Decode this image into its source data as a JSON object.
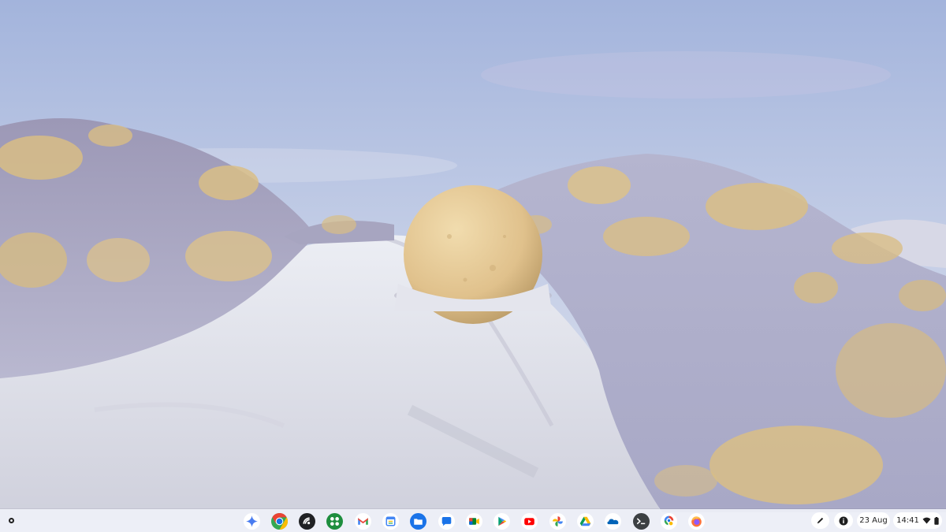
{
  "shelf": {
    "launcher": {
      "icon": "launcher-icon"
    },
    "apps": [
      {
        "name": "gemini",
        "icon": "gemini-icon"
      },
      {
        "name": "chrome",
        "icon": "chrome-icon"
      },
      {
        "name": "android-connect",
        "icon": "android-connect-icon"
      },
      {
        "name": "app-switcher",
        "icon": "apps-grid-icon"
      },
      {
        "name": "gmail",
        "icon": "gmail-icon"
      },
      {
        "name": "calendar",
        "icon": "calendar-icon"
      },
      {
        "name": "files",
        "icon": "files-icon"
      },
      {
        "name": "messages",
        "icon": "messages-icon"
      },
      {
        "name": "google-meet",
        "icon": "meet-icon"
      },
      {
        "name": "play-store",
        "icon": "play-store-icon"
      },
      {
        "name": "youtube",
        "icon": "youtube-icon"
      },
      {
        "name": "google-photos",
        "icon": "photos-icon"
      },
      {
        "name": "google-drive",
        "icon": "drive-icon"
      },
      {
        "name": "onedrive",
        "icon": "onedrive-icon"
      },
      {
        "name": "terminal",
        "icon": "terminal-icon"
      },
      {
        "name": "google-lens",
        "icon": "lens-icon"
      },
      {
        "name": "firefox",
        "icon": "firefox-icon"
      }
    ],
    "tray": {
      "stylus_icon": "stylus-icon",
      "info_icon": "info-icon",
      "date": "23 Aug",
      "time": "14:41",
      "wifi_icon": "wifi-icon",
      "battery_icon": "battery-icon"
    }
  },
  "colors": {
    "sky_top": "#a6b7dd",
    "sky_bottom": "#d8dfee",
    "sand": "#dcdde6",
    "sphere": "#e3c590",
    "brush_lavender": "#b0adc8",
    "brush_gold": "#d9bd86",
    "shelf_bg": "#eef0f7"
  }
}
